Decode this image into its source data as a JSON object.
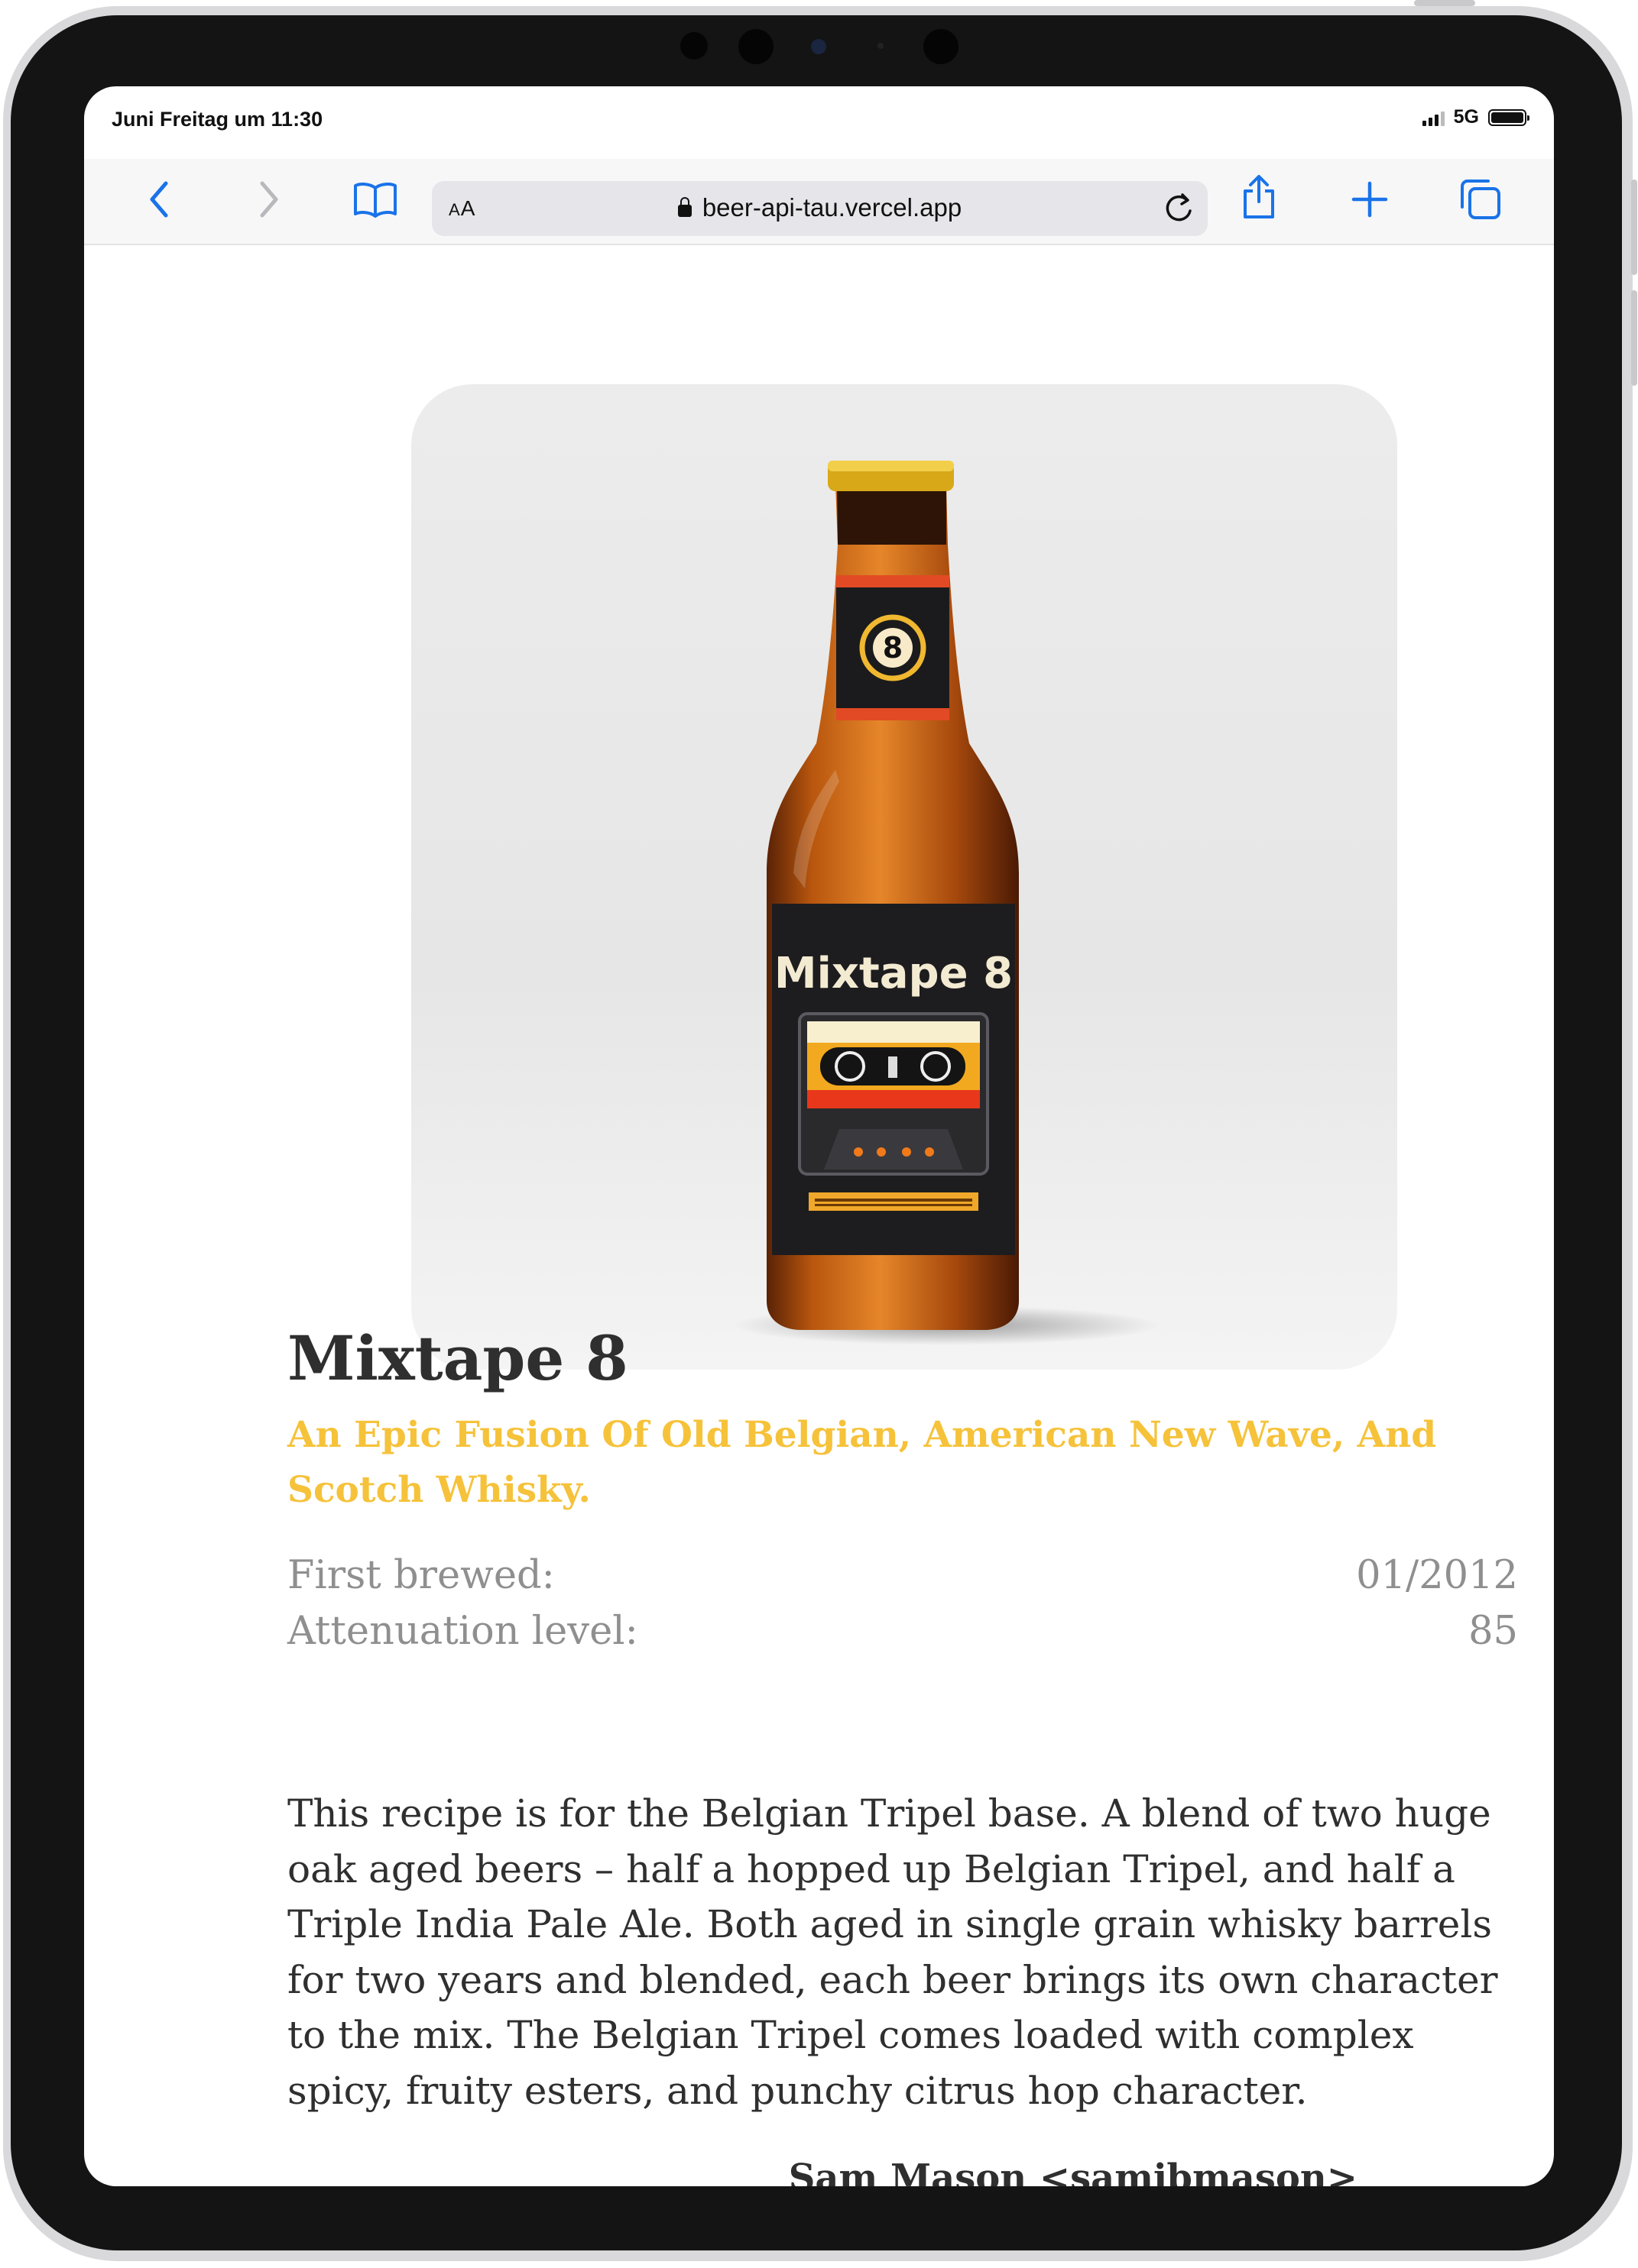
{
  "status_bar": {
    "time": "Juni Freitag um 11:30",
    "network": "5G"
  },
  "browser": {
    "text_size_label": "AA",
    "url": "beer-api-tau.vercel.app",
    "icons": [
      "back-icon",
      "forward-icon",
      "bookmarks-icon",
      "lock-icon",
      "reload-icon",
      "share-icon",
      "new-tab-icon",
      "tabs-icon"
    ]
  },
  "beer": {
    "image_label_text": "Mixtape 8",
    "image_badge_number": "8",
    "name": "Mixtape 8",
    "tagline": "An Epic Fusion Of Old Belgian, American New Wave, And Scotch Whisky.",
    "first_brewed_label": "First brewed:",
    "first_brewed_value": "01/2012",
    "attenuation_label": "Attenuation level:",
    "attenuation_value": "85",
    "description": "This recipe is for the Belgian Tripel base. A blend of two huge oak aged beers – half a hopped up Belgian Tripel, and half a Triple India Pale Ale. Both aged in single grain whisky barrels for two years and blended, each beer brings its own character to the mix. The Belgian Tripel comes loaded with complex spicy, fruity esters, and punchy citrus hop character.",
    "contributor": "Sam Mason <samjbmason>"
  },
  "colors": {
    "accent": "#f5c23a",
    "text": "#2f2f2f",
    "muted": "#8f8f8f",
    "link": "#1a73e8"
  }
}
